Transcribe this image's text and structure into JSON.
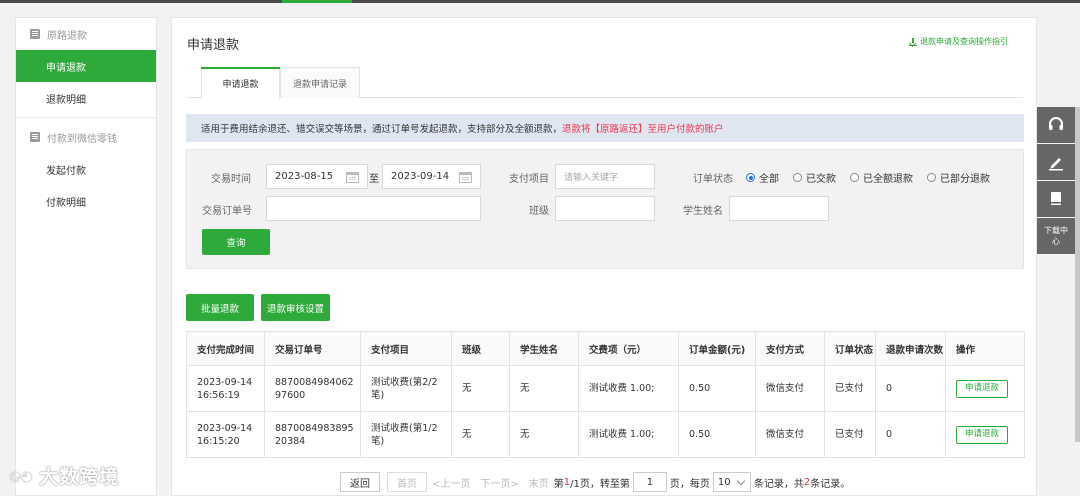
{
  "sidebar": {
    "group1": "原路退款",
    "items1": [
      "申请退款",
      "退款明细"
    ],
    "group2": "付款到微信零钱",
    "items2": [
      "发起付款",
      "付款明细"
    ]
  },
  "page": {
    "title": "申请退款",
    "guide_link": "退款申请及查询操作指引",
    "tabs": [
      "申请退款",
      "退款申请记录"
    ],
    "notice_text": "适用于费用结余退还、错交误交等场景，通过订单号发起退款，支持部分及全额退款，",
    "notice_warn": "退款将【原路返还】至用户付款的账户"
  },
  "filter": {
    "time_label": "交易时间",
    "date_from": "2023-08-15",
    "to_label": "至",
    "date_to": "2023-09-14",
    "pay_item_label": "支付项目",
    "pay_item_placeholder": "请输入关键字",
    "status_label": "订单状态",
    "status_options": [
      "全部",
      "已交款",
      "已全额退款",
      "已部分退款"
    ],
    "status_selected": "全部",
    "order_no_label": "交易订单号",
    "class_label": "班级",
    "student_label": "学生姓名",
    "query_button": "查询"
  },
  "actions": {
    "batch_refund": "批量退款",
    "review_settings": "退款审核设置"
  },
  "table": {
    "columns": [
      "支付完成时间",
      "交易订单号",
      "支付项目",
      "班级",
      "学生姓名",
      "交费项（元）",
      "订单金额(元)",
      "支付方式",
      "订单状态",
      "退款申请次数",
      "操作"
    ],
    "rows": [
      [
        "2023-09-14 16:56:19",
        "887008498406297600",
        "测试收费(第2/2笔)",
        "无",
        "无",
        "测试收费 1.00;",
        "0.50",
        "微信支付",
        "已支付",
        "0",
        "申请退款"
      ],
      [
        "2023-09-14 16:15:20",
        "887008498389520384",
        "测试收费(第1/2笔)",
        "无",
        "无",
        "测试收费 1.00;",
        "0.50",
        "微信支付",
        "已支付",
        "0",
        "申请退款"
      ]
    ]
  },
  "pager": {
    "back": "返回",
    "first": "首页",
    "prev": "<上一页",
    "next": "下一页>",
    "last": "末页",
    "page_info_prefix": "第",
    "page_current": "1",
    "page_info_suffix": "/1页，",
    "goto_label": "转至第",
    "goto_value": "1",
    "page_unit": "页，",
    "per_page_label": "每页",
    "per_page": "10",
    "records_label": "条记录，",
    "total_prefix": "共",
    "total": "2",
    "total_suffix": "条记录。"
  },
  "float": {
    "download_center": "下载中心"
  },
  "watermark": "大数跨境"
}
